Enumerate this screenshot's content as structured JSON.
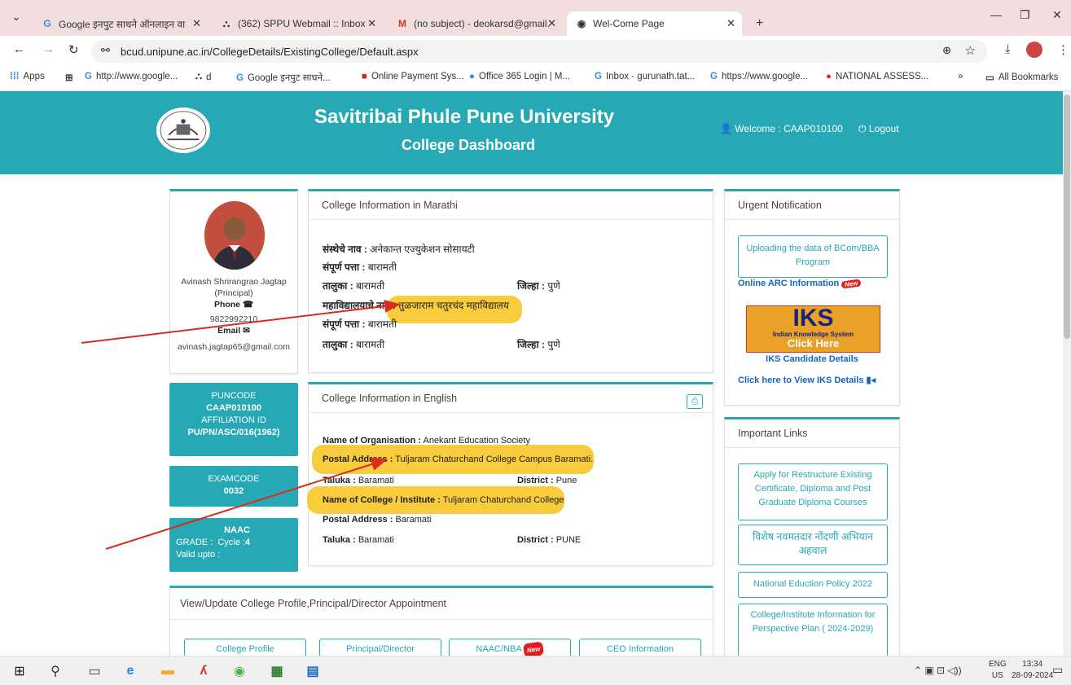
{
  "browser": {
    "tabs": [
      {
        "title": "Google इनपुट साधने ऑनलाइन वा",
        "icon": "G"
      },
      {
        "title": "(362) SPPU Webmail :: Inbox",
        "icon": "⛬"
      },
      {
        "title": "(no subject) - deokarsd@gmail.",
        "icon": "M"
      },
      {
        "title": "Wel-Come Page",
        "icon": "◉"
      }
    ],
    "new_tab": "+",
    "url": "bcud.unipune.ac.in/CollegeDetails/ExistingCollege/Default.aspx",
    "bookmarks": [
      {
        "label": "Apps",
        "icon": "⁞⁞⁞"
      },
      {
        "label": "http://www.google...",
        "icon": "G"
      },
      {
        "label": "d",
        "icon": "⛬"
      },
      {
        "label": "Google इनपुट साधने...",
        "icon": "G"
      },
      {
        "label": "Online Payment Sys...",
        "icon": "■"
      },
      {
        "label": "Office 365 Login | M...",
        "icon": "●"
      },
      {
        "label": "Inbox - gurunath.tat...",
        "icon": "G"
      },
      {
        "label": "https://www.google...",
        "icon": "G"
      },
      {
        "label": "NATIONAL ASSESS...",
        "icon": "●"
      }
    ],
    "all_bookmarks": "All Bookmarks",
    "more": "»"
  },
  "header": {
    "university": "Savitribai Phule Pune University",
    "dashboard": "College Dashboard",
    "welcome": "Welcome : CAAP010100",
    "logout": "Logout"
  },
  "principal": {
    "name": "Avinash Shrirangrao Jagtap",
    "role": "(Principal)",
    "phone_label": "Phone",
    "phone": "9822992210",
    "email_label": "Email",
    "email": "avinash.jagtap65@gmail.com"
  },
  "codes": {
    "puncode_label": "PUNCODE",
    "puncode": "CAAP010100",
    "affiliation_label": "AFFILIATION ID",
    "affiliation": "PU/PN/ASC/016(1962)",
    "examcode_label": "EXAMCODE",
    "examcode": "0032",
    "naac_label": "NAAC",
    "grade_label": "GRADE :",
    "cycle_label": "Cycle :",
    "cycle": "4",
    "valid_label": "Valid upto :"
  },
  "marathi": {
    "heading": "College Information in Marathi",
    "org_label": "संस्थेचे नाव :",
    "org": "अनेकान्त एज्युकेशन सोसायटी",
    "addr_label": "संपूर्ण पत्ता :",
    "addr": "बारामती",
    "taluka_label": "तालुका :",
    "taluka": "बारामती",
    "district_label": "जिल्हा :",
    "district": "पुणे",
    "college_label": "महाविद्यालयाचे नाव :",
    "college": "तुळजाराम चतुरचंद महाविद्यालय",
    "addr2_label": "संपूर्ण पत्ता :",
    "addr2": "बारामती",
    "taluka2_label": "तालुका :",
    "taluka2": "बारामती",
    "district2_label": "जिल्हा :",
    "district2": "पुणे"
  },
  "english": {
    "heading": "College Information in English",
    "org_label": "Name of Organisation :",
    "org": "Anekant Education Society",
    "postal_label": "Postal Address :",
    "postal": "Tuljaram Chaturchand College Campus Baramati.",
    "taluka_label": "Taluka :",
    "taluka": "Baramati",
    "district_label": "District :",
    "district": "Pune",
    "college_label": "Name of College / Institute :",
    "college": "Tuljaram Chaturchand College",
    "postal2_label": "Postal Address :",
    "postal2": "Baramati",
    "taluka2_label": "Taluka :",
    "taluka2": "Baramati",
    "district2_label": "District :",
    "district2": "PUNE"
  },
  "profile": {
    "heading": "View/Update College Profile,Principal/Director Appointment",
    "buttons": [
      "College Profile",
      "Principal/Director",
      "NAAC/NBA",
      "CEO Information"
    ],
    "new": "New"
  },
  "urgent": {
    "heading": "Urgent Notification",
    "upload_btn": "Uploading the data of BCom/BBA Program",
    "arc": "Online ARC Information",
    "iks_title": "IKS",
    "iks_sub": "Indian Knowledge System",
    "iks_click": "Click Here",
    "iks_candidate": "IKS Candidate Details",
    "iks_view": "Click here to View IKS Details"
  },
  "links": {
    "heading": "Important Links",
    "items": [
      "Apply for Restructure Existing Certificate, Diploma and Post Graduate Diploma Courses",
      "विशेष नवमतदार नोंदणी अभियान अहवाल",
      "National Eduction Policy 2022",
      "College/Institute Information for Perspective Plan ( 2024-2029)"
    ]
  },
  "taskbar": {
    "lang": "ENG",
    "region": "US",
    "time": "13:34",
    "date": "28-09-2024"
  },
  "colors": {
    "teal": "#26a8b5",
    "highlight": "#f8cc3c",
    "arrow": "#d62d20"
  }
}
